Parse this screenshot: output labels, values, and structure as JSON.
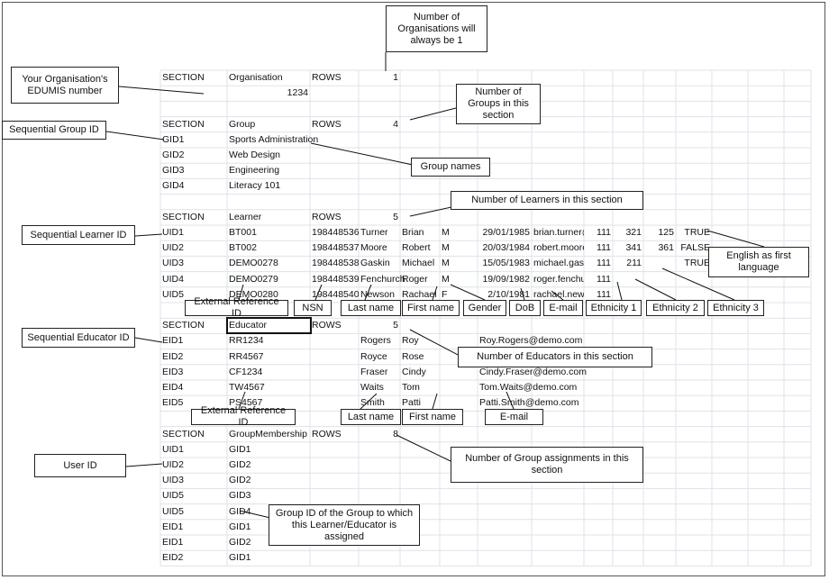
{
  "sheet": {
    "rows": [
      [
        "SECTION",
        "Organisation",
        "ROWS",
        "1"
      ],
      [
        "",
        "1234"
      ],
      [],
      [
        "SECTION",
        "Group",
        "ROWS",
        "4"
      ],
      [
        "GID1",
        "Sports Administration"
      ],
      [
        "GID2",
        "Web Design"
      ],
      [
        "GID3",
        "Engineering"
      ],
      [
        "GID4",
        "Literacy 101"
      ],
      [],
      [
        "SECTION",
        "Learner",
        "ROWS",
        "5"
      ],
      [
        "UID1",
        "BT001",
        "1984485360",
        "Turner",
        "Brian",
        "M",
        "29/01/1985",
        "brian.turner@",
        "111",
        "321",
        "125",
        "TRUE"
      ],
      [
        "UID2",
        "BT002",
        "1984485373",
        "Moore",
        "Robert",
        "M",
        "20/03/1984",
        "robert.moore",
        "111",
        "341",
        "361",
        "FALSE"
      ],
      [
        "UID3",
        "DEMO0278",
        "1984485386",
        "Gaskin",
        "Michael",
        "M",
        "15/05/1983",
        "michael.gaski",
        "111",
        "211",
        "",
        "TRUE"
      ],
      [
        "UID4",
        "DEMO0279",
        "1984485399",
        "Fenchurch",
        "Roger",
        "M",
        "19/09/1982",
        "roger.fenchur",
        "111"
      ],
      [
        "UID5",
        "DEMO0280",
        "1984485409",
        "Newson",
        "Rachael",
        "F",
        "2/10/1981",
        "rachael.newsc",
        "111"
      ],
      [],
      [
        "SECTION",
        "Educator",
        "ROWS",
        "5"
      ],
      [
        "EID1",
        "RR1234",
        "",
        "Rogers",
        "Roy",
        "",
        "Roy.Rogers@demo.com"
      ],
      [
        "EID2",
        "RR4567",
        "",
        "Royce",
        "Rose",
        "",
        "Rose.Royce@demo.com"
      ],
      [
        "EID3",
        "CF1234",
        "",
        "Fraser",
        "Cindy",
        "",
        "Cindy.Fraser@demo.com"
      ],
      [
        "EID4",
        "TW4567",
        "",
        "Waits",
        "Tom",
        "",
        "Tom.Waits@demo.com"
      ],
      [
        "EID5",
        "PS4567",
        "",
        "Smith",
        "Patti",
        "",
        "Patti.Smith@demo.com"
      ],
      [],
      [
        "SECTION",
        "GroupMembership",
        "ROWS",
        "8"
      ],
      [
        "UID1",
        "GID1"
      ],
      [
        "UID2",
        "GID2"
      ],
      [
        "UID3",
        "GID2"
      ],
      [
        "UID5",
        "GID3"
      ],
      [
        "UID5",
        "GID4"
      ],
      [
        "EID1",
        "GID1"
      ],
      [
        "EID1",
        "GID2"
      ],
      [
        "EID2",
        "GID1"
      ]
    ]
  },
  "callouts": {
    "org_count": "Number of Organisations will always be 1",
    "edumis": "Your Organisation's EDUMIS number",
    "group_count": "Number of Groups in this section",
    "group_id": "Sequential Group ID",
    "group_names": "Group names",
    "learner_count": "Number of Learners in this section",
    "learner_id": "Sequential Learner ID",
    "english": "English as first language",
    "l_extref": "External Reference ID",
    "l_nsn": "NSN",
    "l_last": "Last name",
    "l_first": "First name",
    "l_gender": "Gender",
    "l_dob": "DoB",
    "l_email": "E-mail",
    "l_eth1": "Ethnicity 1",
    "l_eth2": "Ethnicity 2",
    "l_eth3": "Ethnicity 3",
    "educator_id": "Sequential Educator ID",
    "educator_count": "Number of Educators in this section",
    "e_extref": "External Reference ID",
    "e_last": "Last name",
    "e_first": "First name",
    "e_email": "E-mail",
    "assign_count": "Number of Group assignments in this section",
    "user_id": "User ID",
    "group_ref": "Group ID of the Group  to which this Learner/Educator is assigned"
  }
}
